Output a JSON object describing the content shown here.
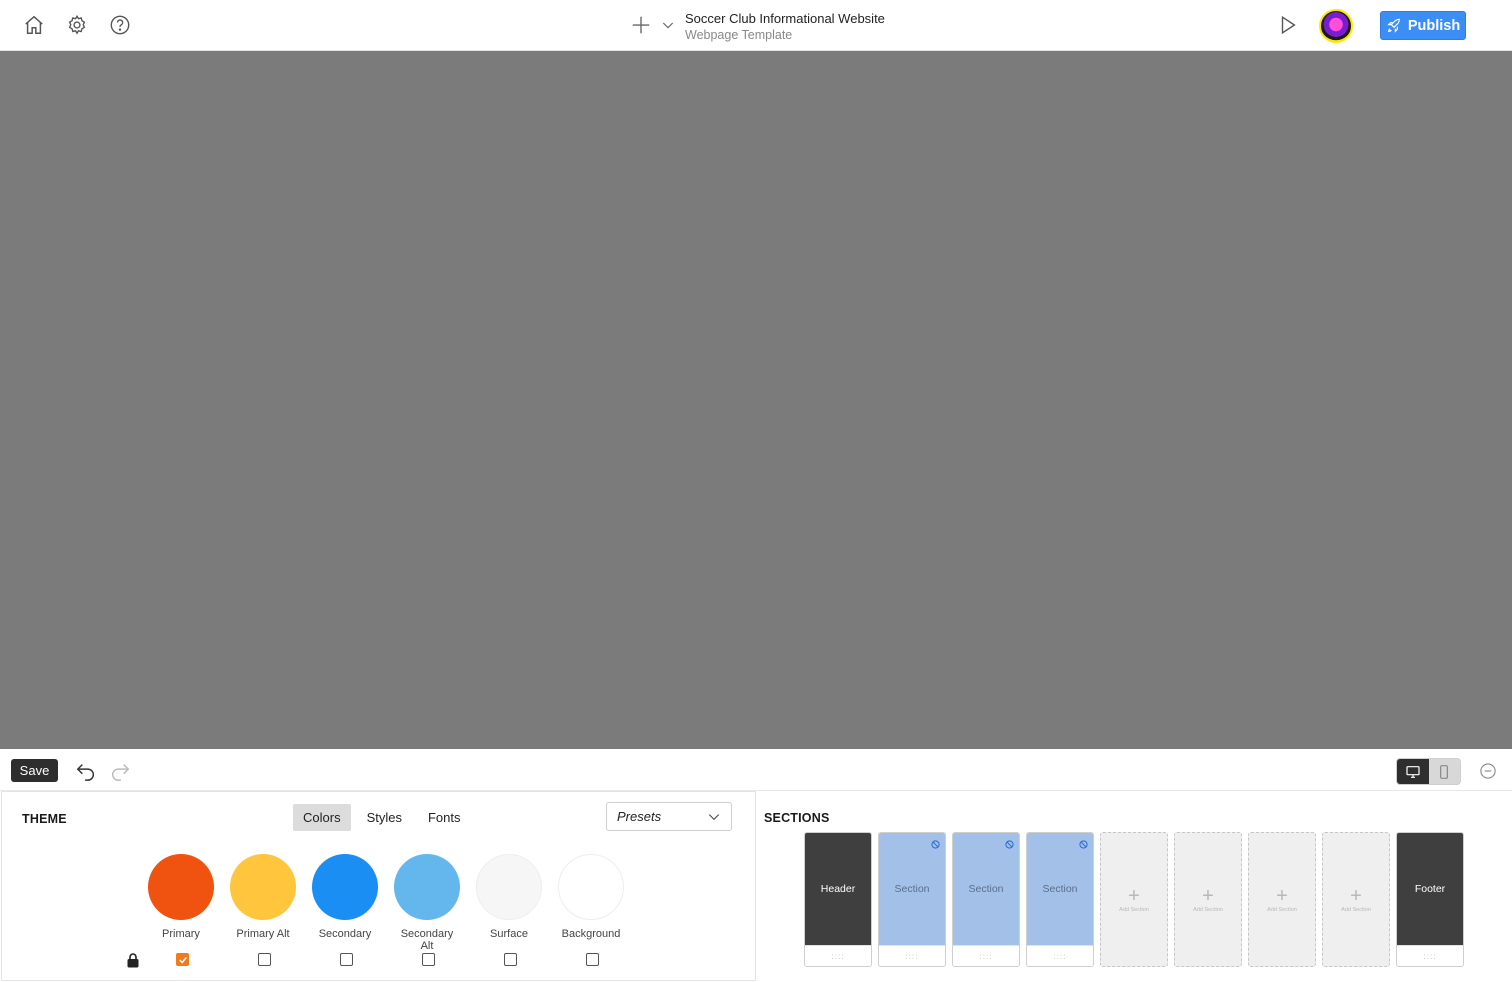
{
  "header": {
    "project_title": "Soccer Club Informational Website",
    "project_subtitle": "Webpage Template",
    "publish_label": "Publish",
    "icons": [
      "home-icon",
      "gear-icon",
      "help-icon",
      "plus-icon",
      "chevron-down-icon",
      "play-icon",
      "rocket-icon"
    ]
  },
  "toolbar": {
    "save_label": "Save"
  },
  "theme": {
    "title": "THEME",
    "tabs": [
      {
        "label": "Colors",
        "active": true
      },
      {
        "label": "Styles",
        "active": false
      },
      {
        "label": "Fonts",
        "active": false
      }
    ],
    "presets_label": "Presets",
    "swatches": [
      {
        "label": "Primary",
        "color": "#f0520f",
        "checked": true
      },
      {
        "label": "Primary Alt",
        "color": "#ffc53d",
        "checked": false
      },
      {
        "label": "Secondary",
        "color": "#1b8ef3",
        "checked": false
      },
      {
        "label": "Secondary Alt",
        "color": "#63b7ec",
        "checked": false
      },
      {
        "label": "Surface",
        "color": "#f6f6f6",
        "checked": false
      },
      {
        "label": "Background",
        "color": "#ffffff",
        "checked": false
      }
    ]
  },
  "sections": {
    "title": "SECTIONS",
    "cards": [
      {
        "label": "Header",
        "kind": "dark"
      },
      {
        "label": "Section",
        "kind": "blue"
      },
      {
        "label": "Section",
        "kind": "blue"
      },
      {
        "label": "Section",
        "kind": "blue"
      },
      {
        "label": "Add Section",
        "kind": "empty"
      },
      {
        "label": "Add Section",
        "kind": "empty"
      },
      {
        "label": "Add Section",
        "kind": "empty"
      },
      {
        "label": "Add Section",
        "kind": "empty"
      },
      {
        "label": "Footer",
        "kind": "dark"
      }
    ]
  }
}
